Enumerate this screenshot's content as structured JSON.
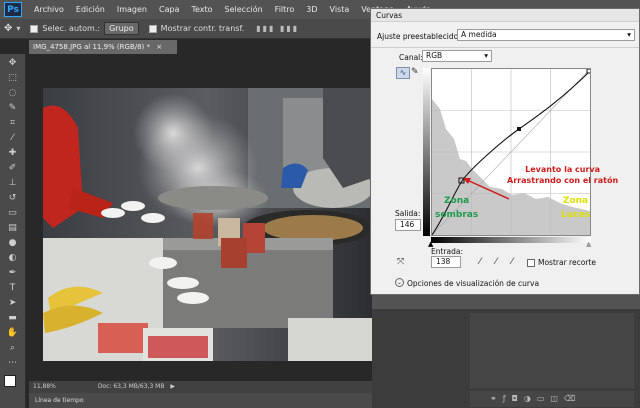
{
  "app": {
    "logo": "Ps"
  },
  "menu": [
    "Archivo",
    "Edición",
    "Imagen",
    "Capa",
    "Texto",
    "Selección",
    "Filtro",
    "3D",
    "Vista",
    "Ventana",
    "Ayuda"
  ],
  "options": {
    "auto_select_label": "Selec. autom.:",
    "group_value": "Grupo",
    "transform_label": "Mostrar contr. transf."
  },
  "document": {
    "tab_title": "IMG_4758.JPG al 11,9% (RGB/8) *",
    "zoom": "11,88%",
    "doc_info": "Doc: 63,3 MB/63,3 MB",
    "timeline_label": "Línea de tiempo"
  },
  "dialog": {
    "title": "Curvas",
    "preset_label": "Ajuste preestablecido:",
    "preset_value": "A medida",
    "channel_label": "Canal:",
    "channel_value": "RGB",
    "output_label": "Salida:",
    "output_value": "146",
    "input_label": "Entrada:",
    "input_value": "138",
    "show_clipping_label": "Mostrar recorte",
    "display_options_label": "Opciones de visualización de curva"
  },
  "annotations": {
    "curve_note_line1": "Levanto la curva",
    "curve_note_line2": "Arrastrando  con el ratón",
    "shadows_line1": "Zona",
    "shadows_line2": "sombras",
    "lights_line1": "Zona",
    "lights_line2": "Luces",
    "colors": {
      "curve_note": "#d11a1a",
      "shadows": "#1f9a4a",
      "lights": "#e8e800"
    }
  },
  "icons": [
    "move-tool-icon",
    "marquee-icon",
    "lasso-icon",
    "quick-select-icon",
    "crop-icon",
    "eyedropper-icon",
    "healing-icon",
    "brush-icon",
    "stamp-icon",
    "history-brush-icon",
    "eraser-icon",
    "gradient-icon",
    "blur-icon",
    "dodge-icon",
    "pen-icon",
    "type-icon",
    "path-select-icon",
    "shape-icon",
    "hand-icon",
    "zoom-icon"
  ]
}
